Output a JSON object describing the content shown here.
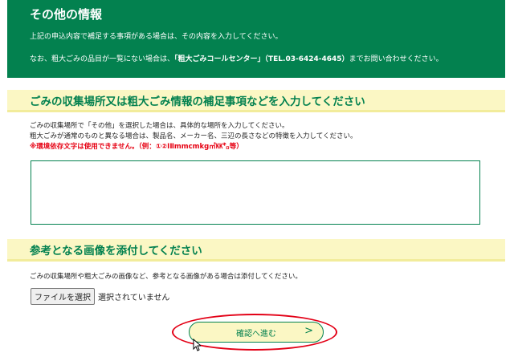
{
  "header": {
    "title": "その他の情報",
    "line1": "上記の申込内容で補足する事項がある場合は、その内容を入力してください。",
    "line2_prefix": "なお、粗大ごみの品目が一覧にない場合は、",
    "line2_center": "「粗大ごみコールセンター」（TEL.03-6424-4645）",
    "line2_suffix": "までお問い合わせください。"
  },
  "section1": {
    "heading": "ごみの収集場所又は粗大ごみ情報の補足事項などを入力してください",
    "help1": "ごみの収集場所で「その他」を選択した場合は、具体的な場所を入力してください。",
    "help2": "粗大ごみが通常のものと異なる場合は、製品名、メーカー名、三辺の長さなどの特徴を入力してください。",
    "warning": "※環境依存文字は使用できません。（例：①②ⅠⅡmmcmkg㎡㏍㌔等）",
    "textarea_value": ""
  },
  "section2": {
    "heading": "参考となる画像を添付してください",
    "help": "ごみの収集場所や粗大ごみの画像など、参考となる画像がある場合は添付してください。",
    "file_button": "ファイルを選択",
    "file_status": "選択されていません"
  },
  "confirm": {
    "label": "確認へ進む",
    "chevron": ">"
  },
  "colors": {
    "brand_green": "#03814f",
    "section_yellow": "#fbf7c4",
    "warning_red": "#e60012",
    "annotation_red": "#e30016"
  }
}
